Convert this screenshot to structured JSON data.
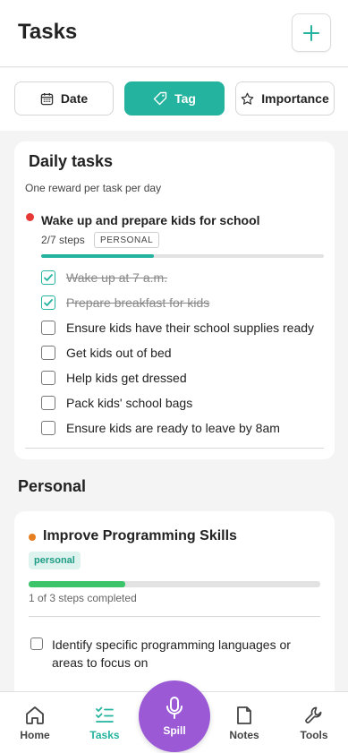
{
  "header": {
    "title": "Tasks",
    "add_icon": "plus-icon"
  },
  "filters": [
    {
      "label": "Date",
      "icon": "calendar-icon",
      "active": false
    },
    {
      "label": "Tag",
      "icon": "tag-icon",
      "active": true
    },
    {
      "label": "Importance",
      "icon": "star-icon",
      "active": false
    }
  ],
  "daily": {
    "title": "Daily tasks",
    "subtitle": "One reward per task per day",
    "task": {
      "title": "Wake up and prepare kids for school",
      "steps_text": "2/7 steps",
      "tag": "PERSONAL",
      "progress": 0.4,
      "dot_color": "#e53935",
      "subtasks": [
        {
          "label": "Wake up at 7 a.m.",
          "done": true
        },
        {
          "label": "Prepare breakfast for kids",
          "done": true
        },
        {
          "label": "Ensure kids have their school supplies ready",
          "done": false
        },
        {
          "label": "Get kids out of bed",
          "done": false
        },
        {
          "label": "Help kids get dressed",
          "done": false
        },
        {
          "label": "Pack kids' school bags",
          "done": false
        },
        {
          "label": "Ensure kids are ready to leave by 8am",
          "done": false
        }
      ]
    }
  },
  "personal": {
    "section_title": "Personal",
    "task": {
      "title": "Improve Programming Skills",
      "tag": "personal",
      "progress": 0.33,
      "dot_color": "#e67e22",
      "progress_text": "1 of 3 steps completed",
      "subtask": {
        "label": "Identify specific programming languages or areas to focus on",
        "done": false
      }
    }
  },
  "nav": {
    "items": [
      {
        "label": "Home",
        "icon": "home-icon",
        "active": false
      },
      {
        "label": "Tasks",
        "icon": "tasks-icon",
        "active": true
      },
      {
        "label": "Notes",
        "icon": "notes-icon",
        "active": false
      },
      {
        "label": "Tools",
        "icon": "wrench-icon",
        "active": false
      }
    ],
    "spill_label": "Spill",
    "spill_icon": "microphone-icon"
  },
  "colors": {
    "accent": "#24b39e",
    "spill": "#9b59d6",
    "progress_green": "#3cc46b"
  }
}
